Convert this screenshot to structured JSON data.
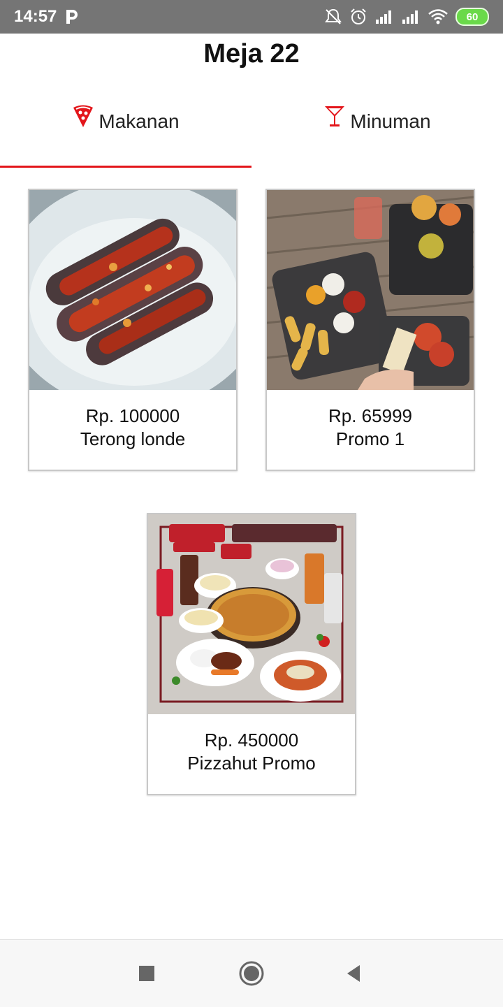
{
  "status_bar": {
    "time": "14:57",
    "battery": "60",
    "icons": [
      "p-icon",
      "mute-icon",
      "alarm-icon",
      "signal-icon",
      "signal-icon",
      "wifi-icon",
      "battery-icon"
    ]
  },
  "page": {
    "title": "Meja 22"
  },
  "tabs": [
    {
      "label": "Makanan",
      "icon": "pizza-icon",
      "selected": true
    },
    {
      "label": "Minuman",
      "icon": "cocktail-glass-icon",
      "selected": false
    }
  ],
  "menu_items": [
    {
      "price": "Rp. 100000",
      "name": "Terong londe",
      "image": "eggplant-dish-photo"
    },
    {
      "price": "Rp. 65999",
      "name": "Promo 1",
      "image": "snack-table-photo"
    },
    {
      "price": "Rp. 450000",
      "name": "Pizzahut Promo",
      "image": "pizza-combo-promo-photo"
    }
  ],
  "nav_bar": {
    "buttons": [
      "recents-button",
      "home-button",
      "back-button"
    ]
  },
  "colors": {
    "accent": "#e3161b",
    "status_bar": "#757575",
    "battery": "#6ad94a"
  }
}
